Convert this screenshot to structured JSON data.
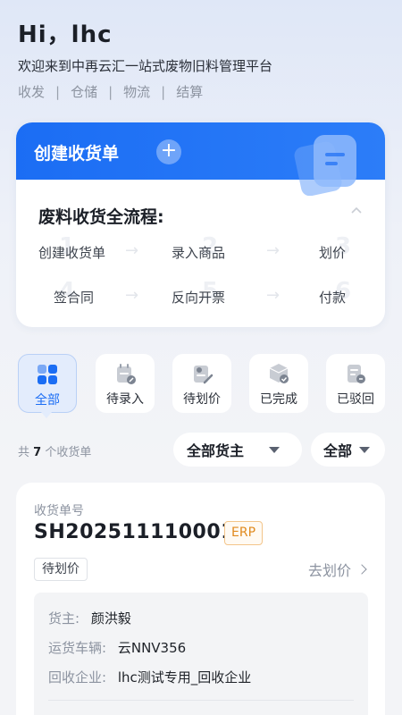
{
  "greeting": {
    "title": "Hi，lhc",
    "subtitle": "欢迎来到中再云汇一站式废物旧料管理平台",
    "tags": [
      "收发",
      "仓储",
      "物流",
      "结算"
    ]
  },
  "create_card": {
    "button_label": "创建收货单",
    "flow_title": "废料收货全流程:",
    "steps": [
      {
        "num": "1",
        "label": "创建收货单"
      },
      {
        "num": "2",
        "label": "录入商品"
      },
      {
        "num": "3",
        "label": "划价"
      },
      {
        "num": "4",
        "label": "签合同"
      },
      {
        "num": "5",
        "label": "反向开票"
      },
      {
        "num": "6",
        "label": "付款"
      }
    ]
  },
  "filters": [
    {
      "label": "全部",
      "icon": "grid-icon",
      "active": true
    },
    {
      "label": "待录入",
      "icon": "calendar-edit-icon",
      "active": false
    },
    {
      "label": "待划价",
      "icon": "price-tag-icon",
      "active": false
    },
    {
      "label": "已完成",
      "icon": "box-check-icon",
      "active": false
    },
    {
      "label": "已驳回",
      "icon": "doc-reject-icon",
      "active": false
    }
  ],
  "list_header": {
    "count_prefix": "共",
    "count": "7",
    "count_suffix": "个收货单",
    "owner_filter": "全部货主",
    "type_filter": "全部"
  },
  "order": {
    "label": "收货单号",
    "number": "SH202511110001",
    "badge": "ERP",
    "status": "待划价",
    "action": "去划价",
    "details": [
      {
        "key": "货主:",
        "value": "颜洪毅"
      },
      {
        "key": "运货车辆:",
        "value": "云NNV356"
      },
      {
        "key": "回收企业:",
        "value": "lhc测试专用_回收企业"
      }
    ]
  },
  "colors": {
    "accent": "#1b6df4",
    "erp": "#e08a1e"
  }
}
